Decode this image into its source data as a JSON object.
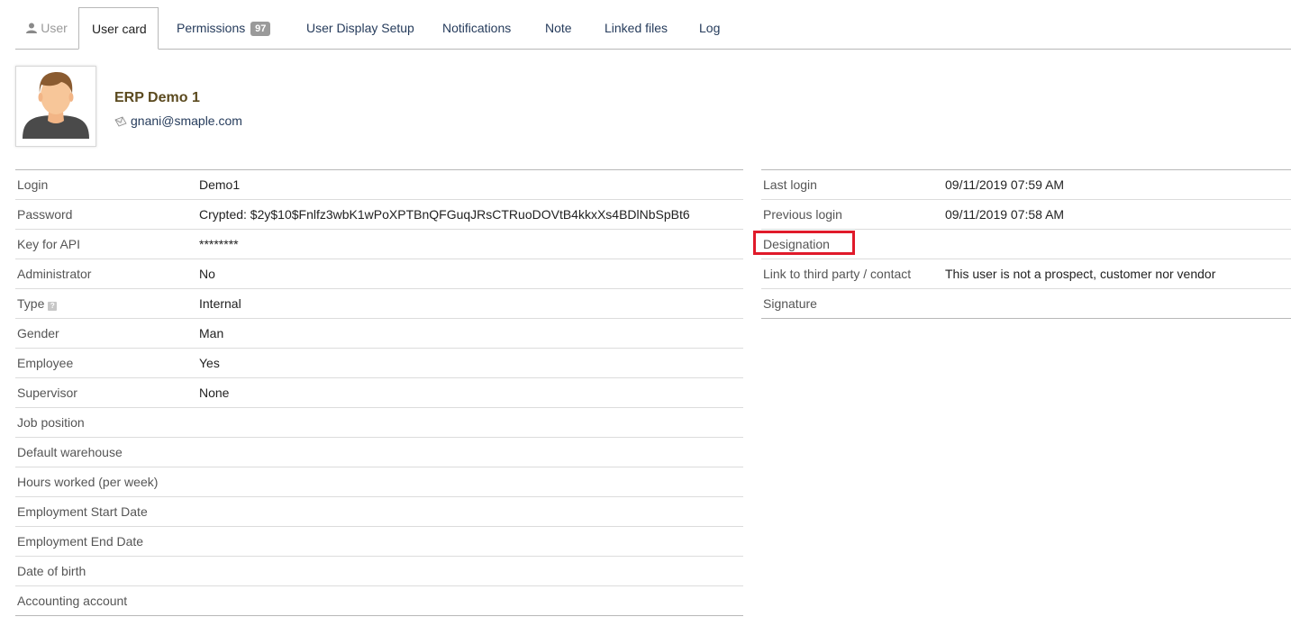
{
  "tabs": [
    {
      "label": "User"
    },
    {
      "label": "User card"
    },
    {
      "label": "Permissions",
      "badge": "97"
    },
    {
      "label": "User Display Setup"
    },
    {
      "label": "Notifications"
    },
    {
      "label": "Note"
    },
    {
      "label": "Linked files"
    },
    {
      "label": "Log"
    }
  ],
  "header": {
    "name": "ERP Demo 1",
    "email": "gnani@smaple.com"
  },
  "left_fields": [
    {
      "label": "Login",
      "value": "Demo1"
    },
    {
      "label": "Password",
      "value": "Crypted: $2y$10$Fnlfz3wbK1wPoXPTBnQFGuqJRsCTRuoDOVtB4kkxXs4BDlNbSpBt6"
    },
    {
      "label": "Key for API",
      "value": "********"
    },
    {
      "label": "Administrator",
      "value": "No"
    },
    {
      "label": "Type",
      "value": "Internal"
    },
    {
      "label": "Gender",
      "value": "Man"
    },
    {
      "label": "Employee",
      "value": "Yes"
    },
    {
      "label": "Supervisor",
      "value": "None"
    },
    {
      "label": "Job position",
      "value": ""
    },
    {
      "label": "Default warehouse",
      "value": ""
    },
    {
      "label": "Hours worked (per week)",
      "value": ""
    },
    {
      "label": "Employment Start Date",
      "value": ""
    },
    {
      "label": "Employment End Date",
      "value": ""
    },
    {
      "label": "Date of birth",
      "value": ""
    },
    {
      "label": "Accounting account",
      "value": ""
    }
  ],
  "right_fields": [
    {
      "label": "Last login",
      "value": "09/11/2019 07:59 AM"
    },
    {
      "label": "Previous login",
      "value": "09/11/2019 07:58 AM"
    },
    {
      "label": "Designation",
      "value": ""
    },
    {
      "label": "Link to third party / contact",
      "value": "This user is not a prospect, customer nor vendor"
    },
    {
      "label": "Signature",
      "value": ""
    }
  ],
  "help_icon_glyph": "?",
  "colors": {
    "highlight": "#e01a2a",
    "name": "#5b4a1f",
    "link": "#263c5c"
  }
}
